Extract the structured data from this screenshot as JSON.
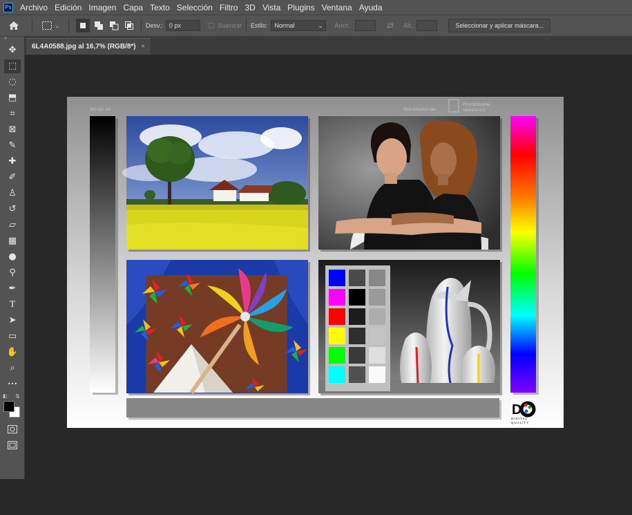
{
  "app": {
    "logo": "Ps"
  },
  "menu": [
    "Archivo",
    "Edición",
    "Imagen",
    "Capa",
    "Texto",
    "Selección",
    "Filtro",
    "3D",
    "Vista",
    "Plugins",
    "Ventana",
    "Ayuda"
  ],
  "options": {
    "feather_label": "Desv.:",
    "feather_value": "0 px",
    "antialias_label": "Suavizar",
    "style_label": "Estilo:",
    "style_value": "Normal",
    "width_label": "Anch.:",
    "height_label": "Alt.:",
    "mask_button": "Seleccionar y aplicar máscara..."
  },
  "document_tab": {
    "title": "6L4A0588.jpg al 16,7% (RGB/8*)",
    "close": "×"
  },
  "tools": [
    "move-tool-icon",
    "rectangular-marquee-tool-icon",
    "lasso-tool-icon",
    "object-selection-tool-icon",
    "crop-tool-icon",
    "frame-tool-icon",
    "eyedropper-tool-icon",
    "healing-brush-tool-icon",
    "brush-tool-icon",
    "clone-stamp-tool-icon",
    "history-brush-tool-icon",
    "eraser-tool-icon",
    "gradient-tool-icon",
    "blur-tool-icon",
    "dodge-tool-icon",
    "pen-tool-icon",
    "type-tool-icon",
    "path-selection-tool-icon",
    "rectangle-tool-icon",
    "hand-tool-icon",
    "zoom-tool-icon",
    "more-tools-icon"
  ],
  "colors": {
    "foreground": "#000000",
    "background": "#ffffff",
    "chrome": "#535353",
    "canvas_bg": "#282828"
  },
  "document": {
    "header_left": "300 ppi, A4",
    "header_right_1": "Eine Initiative des",
    "header_right_2": "Photoindustrie-",
    "header_right_3": "Verband e.V.",
    "logo_sub_1": "DIGITAL",
    "logo_sub_2": "QUALITY"
  }
}
